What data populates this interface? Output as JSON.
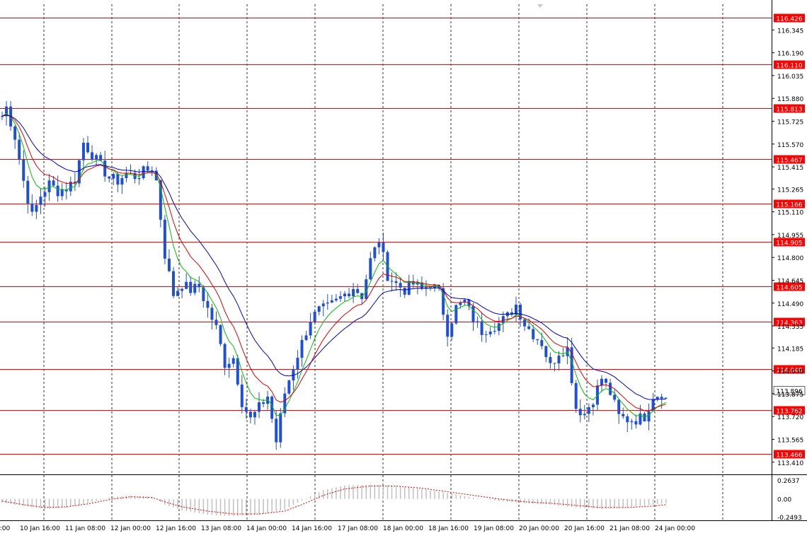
{
  "chart_data": [
    {
      "type": "candlestick",
      "title": "",
      "xlabel": "",
      "ylabel": "",
      "ylim": [
        113.38,
        116.5
      ],
      "grid": true,
      "colors": {
        "candles": "#1f4fd8",
        "fast_ma": "#00c000",
        "mid_ma": "#e00000",
        "slow_ma": "#0000c8",
        "levels": "#ff0000",
        "level_label_bg": "#ff0000",
        "price_label_bg": "#ffffff",
        "grid": "#000000"
      },
      "y_tick_labels": [
        "116.345",
        "116.190",
        "116.035",
        "115.880",
        "115.725",
        "115.570",
        "115.415",
        "115.265",
        "115.110",
        "114.955",
        "114.800",
        "114.645",
        "114.490",
        "114.335",
        "114.185",
        "114.030",
        "113.875",
        "113.720",
        "113.565",
        "113.410"
      ],
      "x_tick_labels": [
        "0:00",
        "10 Jan 16:00",
        "11 Jan 08:00",
        "12 Jan 00:00",
        "12 Jan 16:00",
        "13 Jan 08:00",
        "14 Jan 00:00",
        "14 Jan 16:00",
        "17 Jan 08:00",
        "18 Jan 00:00",
        "18 Jan 16:00",
        "19 Jan 08:00",
        "20 Jan 00:00",
        "20 Jan 16:00",
        "21 Jan 08:00",
        "24 Jan 00:00"
      ],
      "horizontal_levels": [
        "116.426",
        "116.110",
        "115.813",
        "115.467",
        "115.166",
        "114.905",
        "114.605",
        "114.363",
        "114.040",
        "113.762",
        "113.466"
      ],
      "current_price": "113.896",
      "price_path": [
        [
          0,
          115.76
        ],
        [
          1,
          115.82
        ],
        [
          3,
          115.62
        ],
        [
          5,
          115.32
        ],
        [
          7,
          115.08
        ],
        [
          9,
          115.22
        ],
        [
          11,
          115.3
        ],
        [
          13,
          115.25
        ],
        [
          15,
          115.27
        ],
        [
          17,
          115.33
        ],
        [
          19,
          115.58
        ],
        [
          21,
          115.5
        ],
        [
          23,
          115.42
        ],
        [
          25,
          115.34
        ],
        [
          27,
          115.32
        ],
        [
          29,
          115.37
        ],
        [
          31,
          115.35
        ],
        [
          33,
          115.38
        ],
        [
          35,
          115.41
        ],
        [
          36,
          115.32
        ],
        [
          38,
          114.82
        ],
        [
          40,
          114.55
        ],
        [
          42,
          114.62
        ],
        [
          44,
          114.58
        ],
        [
          46,
          114.6
        ],
        [
          48,
          114.45
        ],
        [
          50,
          114.32
        ],
        [
          52,
          114.08
        ],
        [
          54,
          114.12
        ],
        [
          56,
          113.82
        ],
        [
          58,
          113.7
        ],
        [
          60,
          113.78
        ],
        [
          62,
          113.86
        ],
        [
          64,
          113.55
        ],
        [
          66,
          113.88
        ],
        [
          68,
          114.06
        ],
        [
          70,
          114.22
        ],
        [
          72,
          114.38
        ],
        [
          74,
          114.44
        ],
        [
          76,
          114.46
        ],
        [
          78,
          114.5
        ],
        [
          80,
          114.55
        ],
        [
          82,
          114.6
        ],
        [
          84,
          114.54
        ],
        [
          86,
          114.78
        ],
        [
          88,
          114.92
        ],
        [
          90,
          114.68
        ],
        [
          92,
          114.62
        ],
        [
          94,
          114.58
        ],
        [
          96,
          114.62
        ],
        [
          98,
          114.58
        ],
        [
          100,
          114.62
        ],
        [
          102,
          114.56
        ],
        [
          104,
          114.3
        ],
        [
          106,
          114.46
        ],
        [
          108,
          114.5
        ],
        [
          110,
          114.38
        ],
        [
          112,
          114.3
        ],
        [
          114,
          114.33
        ],
        [
          116,
          114.35
        ],
        [
          118,
          114.4
        ],
        [
          120,
          114.48
        ],
        [
          122,
          114.35
        ],
        [
          124,
          114.28
        ],
        [
          126,
          114.22
        ],
        [
          128,
          114.06
        ],
        [
          130,
          114.16
        ],
        [
          132,
          114.18
        ],
        [
          134,
          113.78
        ],
        [
          136,
          113.74
        ],
        [
          138,
          113.84
        ],
        [
          140,
          113.98
        ],
        [
          142,
          113.88
        ],
        [
          144,
          113.72
        ],
        [
          146,
          113.7
        ],
        [
          148,
          113.7
        ],
        [
          150,
          113.72
        ],
        [
          152,
          113.86
        ],
        [
          154,
          113.88
        ],
        [
          155,
          113.84
        ]
      ],
      "indicator_panel": {
        "name": "",
        "y_tick_labels": [
          "0.2637",
          "0.00",
          "-0.2493"
        ],
        "ylim": [
          -0.2493,
          0.2637
        ],
        "histogram": [
          [
            0,
            -0.05
          ],
          [
            5,
            -0.1
          ],
          [
            10,
            -0.14
          ],
          [
            15,
            -0.12
          ],
          [
            20,
            -0.06
          ],
          [
            25,
            0.02
          ],
          [
            30,
            0.05
          ],
          [
            35,
            0.03
          ],
          [
            38,
            -0.08
          ],
          [
            42,
            -0.16
          ],
          [
            48,
            -0.22
          ],
          [
            54,
            -0.24
          ],
          [
            60,
            -0.22
          ],
          [
            66,
            -0.15
          ],
          [
            70,
            -0.02
          ],
          [
            75,
            0.12
          ],
          [
            80,
            0.19
          ],
          [
            86,
            0.2
          ],
          [
            92,
            0.18
          ],
          [
            98,
            0.14
          ],
          [
            104,
            0.08
          ],
          [
            110,
            0.02
          ],
          [
            116,
            -0.03
          ],
          [
            122,
            -0.06
          ],
          [
            128,
            -0.08
          ],
          [
            134,
            -0.12
          ],
          [
            140,
            -0.14
          ],
          [
            146,
            -0.12
          ],
          [
            152,
            -0.08
          ],
          [
            155,
            -0.06
          ]
        ],
        "signal": [
          [
            0,
            -0.03
          ],
          [
            5,
            -0.08
          ],
          [
            10,
            -0.12
          ],
          [
            15,
            -0.11
          ],
          [
            20,
            -0.07
          ],
          [
            25,
            -0.01
          ],
          [
            30,
            0.03
          ],
          [
            35,
            0.02
          ],
          [
            38,
            -0.04
          ],
          [
            42,
            -0.11
          ],
          [
            48,
            -0.17
          ],
          [
            54,
            -0.21
          ],
          [
            60,
            -0.21
          ],
          [
            66,
            -0.17
          ],
          [
            70,
            -0.08
          ],
          [
            75,
            0.05
          ],
          [
            80,
            0.14
          ],
          [
            86,
            0.18
          ],
          [
            92,
            0.18
          ],
          [
            98,
            0.15
          ],
          [
            104,
            0.1
          ],
          [
            110,
            0.05
          ],
          [
            116,
            0.0
          ],
          [
            122,
            -0.04
          ],
          [
            128,
            -0.06
          ],
          [
            134,
            -0.09
          ],
          [
            140,
            -0.12
          ],
          [
            146,
            -0.12
          ],
          [
            152,
            -0.1
          ],
          [
            155,
            -0.08
          ]
        ]
      }
    }
  ]
}
